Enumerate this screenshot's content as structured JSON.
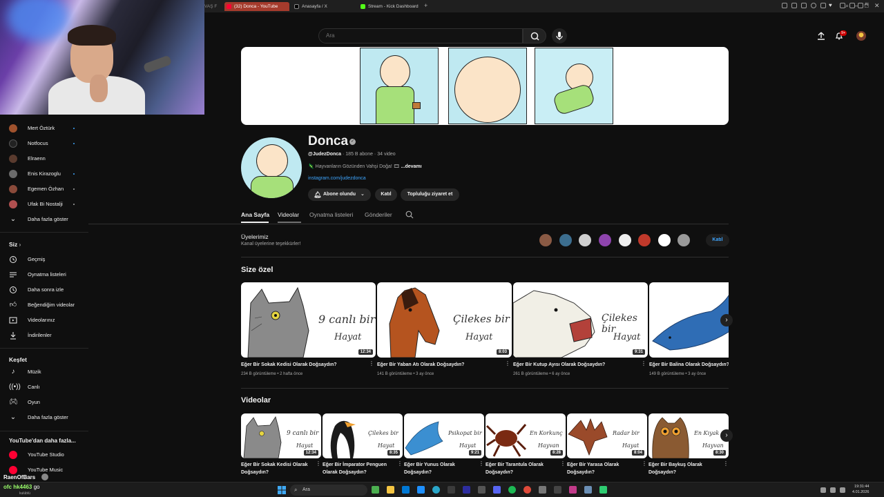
{
  "browser": {
    "tabs": [
      {
        "label": "VAŞ F",
        "active": false
      },
      {
        "label": "(32) Donca - YouTube",
        "active": true
      },
      {
        "label": "Anasayfa / X",
        "active": false
      },
      {
        "label": "Stream - Kick Dashboard",
        "active": false
      }
    ],
    "ai_label": "AI"
  },
  "header": {
    "search_placeholder": "Ara",
    "notifications_badge": "9+"
  },
  "sidebar": {
    "subscriptions": [
      {
        "label": "Mert Öztürk",
        "color": "#a0522d"
      },
      {
        "label": "Notfocus",
        "color": "#222222"
      },
      {
        "label": "Elraenn",
        "color": "#5a3b2e"
      },
      {
        "label": "Enis Kirazoglu",
        "color": "#6b6b6b"
      },
      {
        "label": "Egemen Özhan",
        "color": "#8a4a3a"
      },
      {
        "label": "Ufak Bi Nostalji",
        "color": "#b05050"
      }
    ],
    "show_more": "Daha fazla göster",
    "you_title": "Siz",
    "you_items": [
      "Geçmiş",
      "Oynatma listeleri",
      "Daha sonra izle",
      "Beğendiğim videolar",
      "Videolarınız",
      "İndirilenler"
    ],
    "explore_title": "Keşfet",
    "explore_items": [
      "Müzik",
      "Canlı",
      "Oyun"
    ],
    "explore_more": "Daha fazla göster",
    "more_title": "YouTube'dan daha fazla...",
    "more_items": [
      "YouTube Studio",
      "YouTube Music"
    ]
  },
  "channel": {
    "name": "Donca",
    "handle": "@JudezDonca",
    "stats": " · 185 B abone · 34 video",
    "description": "🦎 Hayvanların Gözünden Vahşi Doğa! 🎞 ",
    "more": "...devamı",
    "link": "instagram.com/judezdonca",
    "subscribed_label": "Abone olundu",
    "join_label": "Katıl",
    "community_label": "Topluluğu ziyaret et"
  },
  "tabs": [
    "Ana Sayfa",
    "Videolar",
    "Oynatma listeleri",
    "Gönderiler"
  ],
  "members": {
    "title": "Üyelerimiz",
    "subtitle": "Kanal üyelerine teşekkürler!",
    "join_label": "Katıl",
    "avatar_colors": [
      "#8a5a44",
      "#3c6e8f",
      "#cfcfcf",
      "#8e44ad",
      "#eeeeee",
      "#c0392b",
      "#ffffff",
      "#999999"
    ]
  },
  "for_you": {
    "title": "Size özel",
    "videos": [
      {
        "title": "Eğer Bir Sokak Kedisi Olarak Doğsaydın?",
        "meta": "234 B görüntüleme • 2 hafta önce",
        "duration": "12:34",
        "hand1": "9 canlı bir",
        "hand2": "Hayat",
        "animal": "cat"
      },
      {
        "title": "Eğer Bir Yaban Atı Olarak Doğsaydın?",
        "meta": "141 B görüntüleme • 3 ay önce",
        "duration": "8:03",
        "hand1": "Çilekes bir",
        "hand2": "Hayat",
        "animal": "horse"
      },
      {
        "title": "Eğer Bir Kutup Ayısı Olarak Doğsaydın?",
        "meta": "261 B görüntüleme • 6 ay önce",
        "duration": "9:31",
        "hand1": "Çilekes bir",
        "hand2": "Hayat",
        "animal": "bear"
      },
      {
        "title": "Eğer Bir Balina Olarak Doğsaydın?",
        "meta": "149 B görüntüleme • 3 ay önce",
        "duration": "",
        "hand1": "",
        "hand2": "",
        "animal": "whale"
      }
    ]
  },
  "videos_section": {
    "title": "Videolar",
    "videos": [
      {
        "title": "Eğer Bir Sokak Kedisi Olarak Doğsaydın?",
        "duration": "12:34",
        "hand1": "9 canlı bir",
        "hand2": "Hayat",
        "animal": "cat"
      },
      {
        "title": "Eğer Bir İmparator Penguen Olarak Doğsaydın?",
        "duration": "8:35",
        "hand1": "Çilekes bir",
        "hand2": "Hayat",
        "animal": "penguin"
      },
      {
        "title": "Eğer Bir Yunus Olarak Doğsaydın?",
        "duration": "9:21",
        "hand1": "Psikopat bir",
        "hand2": "Hayat",
        "animal": "dolphin"
      },
      {
        "title": "Eğer Bir Tarantula Olarak Doğsaydın?",
        "duration": "8:28",
        "hand1": "En Korkunç",
        "hand2": "Hayvan",
        "animal": "spider"
      },
      {
        "title": "Eğer Bir Yarasa Olarak Doğsaydın?",
        "duration": "8:04",
        "hand1": "Radar bir",
        "hand2": "Hayat",
        "animal": "bat"
      },
      {
        "title": "Eğer Bir Baykuş Olarak Doğsaydın?",
        "duration": "8:30",
        "hand1": "En Kıyak",
        "hand2": "Hayvan",
        "animal": "owl"
      }
    ]
  },
  "taskbar": {
    "search_label": "Ara",
    "time": "19:31:44",
    "date": "4.01.2026"
  },
  "stream_overlay": {
    "name": "RaenOfBars",
    "chat_user": "ofc hk4463",
    "chat_text": "go",
    "sub_note": "kulüblü"
  }
}
